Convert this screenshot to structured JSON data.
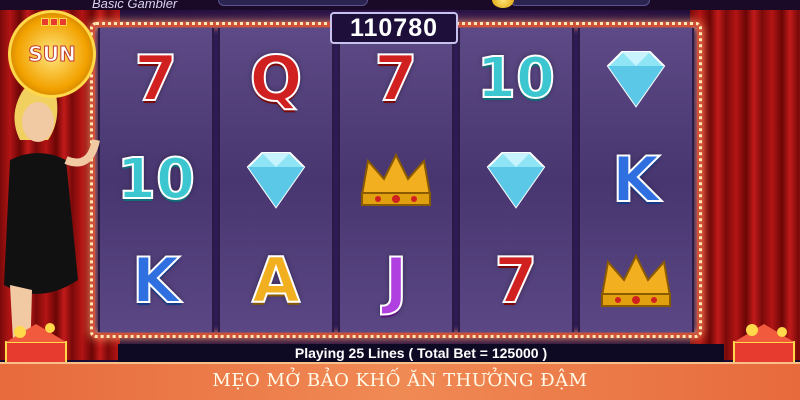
{
  "header": {
    "rank_title": "Basic Gambler"
  },
  "win_counter": "110780",
  "reels": [
    {
      "symbols": [
        {
          "label": "7",
          "kind": "seven"
        },
        {
          "label": "10",
          "kind": "ten"
        },
        {
          "label": "K",
          "kind": "king"
        }
      ]
    },
    {
      "symbols": [
        {
          "label": "Q",
          "kind": "queen"
        },
        {
          "label": "",
          "kind": "diamond"
        },
        {
          "label": "A",
          "kind": "ace"
        }
      ]
    },
    {
      "symbols": [
        {
          "label": "7",
          "kind": "seven"
        },
        {
          "label": "",
          "kind": "crown"
        },
        {
          "label": "J",
          "kind": "jack"
        }
      ]
    },
    {
      "symbols": [
        {
          "label": "10",
          "kind": "ten"
        },
        {
          "label": "",
          "kind": "diamond"
        },
        {
          "label": "7",
          "kind": "seven"
        }
      ]
    },
    {
      "symbols": [
        {
          "label": "",
          "kind": "diamond"
        },
        {
          "label": "K",
          "kind": "king"
        },
        {
          "label": "",
          "kind": "crown"
        }
      ]
    }
  ],
  "status_line": "Playing 25 Lines ( Total Bet = 125000 )",
  "banner": {
    "headline": "MẸO MỞ BẢO KHỐ ĂN THƯỞNG ĐẬM"
  },
  "logo": {
    "text": "SUN"
  },
  "colors": {
    "frame": "#d0503a",
    "banner": "#e76a3c",
    "curtain": "#b31414",
    "reel_bg": "#4a3870"
  }
}
